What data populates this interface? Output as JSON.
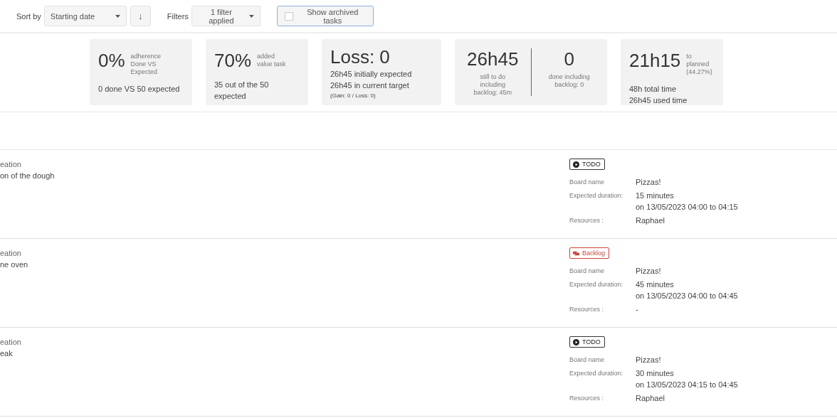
{
  "toolbar": {
    "sort_label": "Sort by",
    "sort_select": "Starting date",
    "sort_direction": "↓",
    "filters_label": "Filters",
    "filter_select": "1 filter applied",
    "archived_toggle": {
      "label": "Show archived tasks",
      "checked": false
    }
  },
  "stats": [
    {
      "kind": "metric",
      "value": "0%",
      "caption": [
        "adherence",
        "Done VS Expected"
      ],
      "details": [
        "0 done VS 50 expected"
      ]
    },
    {
      "kind": "metric",
      "value": "70%",
      "caption": [
        "added",
        "value task"
      ],
      "details": [
        "35 out of the 50 expected"
      ]
    },
    {
      "kind": "summary",
      "value": "Loss: 0",
      "details": [
        "26h45 initially expected",
        "26h45 in current target"
      ],
      "note": "(Gain: 0 / Loss: 0)"
    },
    {
      "kind": "split",
      "parts": [
        {
          "value": "26h45",
          "caption": [
            "still to do",
            "including",
            "backlog: 45m"
          ]
        },
        {
          "value": "0",
          "caption": [
            "done including",
            "backlog: 0"
          ]
        }
      ]
    },
    {
      "kind": "metric",
      "value": "21h15",
      "caption": [
        "to planned",
        "(44.27%)"
      ],
      "details": [
        "48h total time",
        "26h45 used time"
      ]
    }
  ],
  "tasks": [
    {
      "title": "eation",
      "subtitle": "on of the dough",
      "status": {
        "kind": "todo",
        "label": "TODO"
      },
      "details": [
        {
          "label": "Board name",
          "values": [
            "Pizzas!"
          ]
        },
        {
          "label": "Expected duration:",
          "values": [
            "15 minutes",
            "on 13/05/2023 04:00 to 04:15"
          ]
        },
        {
          "label": "Resources :",
          "values": [
            "Raphael"
          ]
        }
      ]
    },
    {
      "title": "eation",
      "subtitle": "ne oven",
      "status": {
        "kind": "backlog",
        "label": "Backlog"
      },
      "details": [
        {
          "label": "Board name",
          "values": [
            "Pizzas!"
          ]
        },
        {
          "label": "Expected duration:",
          "values": [
            "45 minutes",
            "on 13/05/2023 04:00 to 04:45"
          ]
        },
        {
          "label": "Resources :",
          "values": [
            "-"
          ]
        }
      ]
    },
    {
      "title": "eation",
      "subtitle": "eak",
      "status": {
        "kind": "todo",
        "label": "TODO"
      },
      "details": [
        {
          "label": "Board name",
          "values": [
            "Pizzas!"
          ]
        },
        {
          "label": "Expected duration:",
          "values": [
            "30 minutes",
            "on 13/05/2023 04:15 to 04:45"
          ]
        },
        {
          "label": "Resources :",
          "values": [
            "Raphael"
          ]
        }
      ]
    }
  ]
}
